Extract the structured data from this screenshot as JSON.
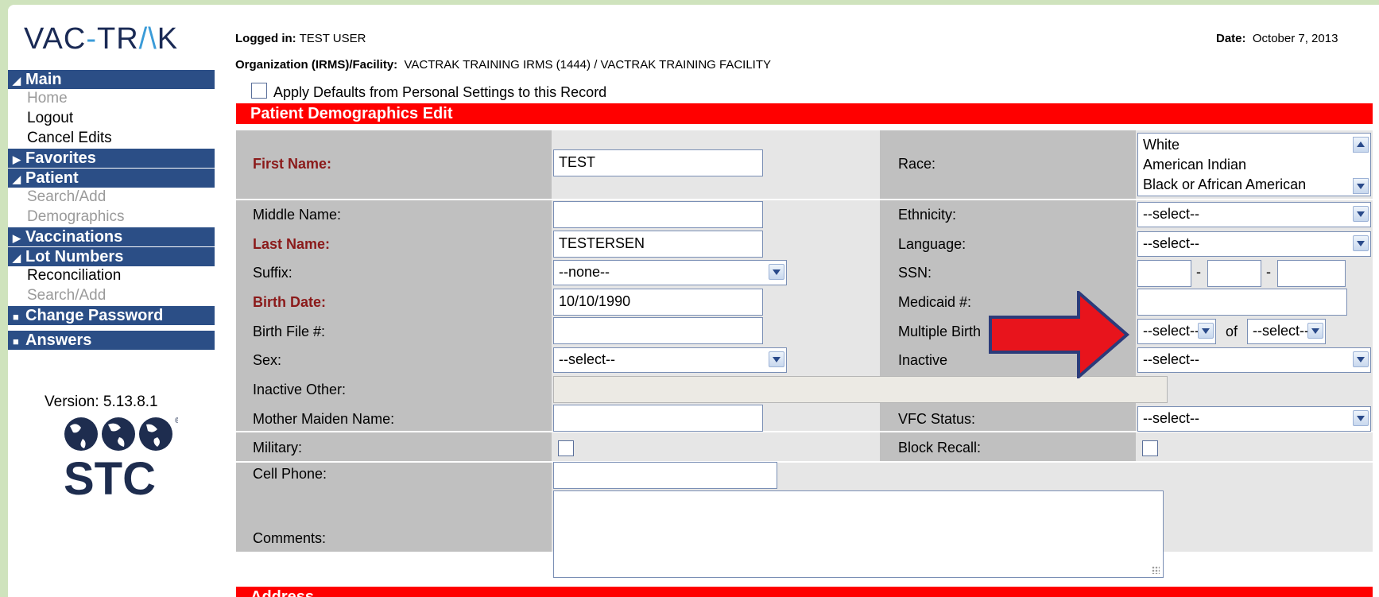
{
  "app": {
    "logo": "VACTRAK",
    "version": "Version: 5.13.8.1",
    "vendor_logo": "STC"
  },
  "sidebar": {
    "main": {
      "label": "Main",
      "items": [
        "Home",
        "Logout",
        "Cancel Edits"
      ]
    },
    "favorites": {
      "label": "Favorites"
    },
    "patient": {
      "label": "Patient",
      "items": [
        "Search/Add",
        "Demographics"
      ]
    },
    "vaccinations": {
      "label": "Vaccinations"
    },
    "lot_numbers": {
      "label": "Lot Numbers",
      "items": [
        "Reconciliation",
        "Search/Add"
      ]
    },
    "change_password": {
      "label": "Change Password"
    },
    "answers": {
      "label": "Answers"
    }
  },
  "header": {
    "logged_in_label": "Logged in:",
    "logged_in_value": "TEST USER",
    "org_label": "Organization (IRMS)/Facility:",
    "org_value": "VACTRAK TRAINING IRMS (1444) / VACTRAK TRAINING FACILITY",
    "date_label": "Date:",
    "date_value": "October 7, 2013",
    "apply_defaults": "Apply Defaults from Personal Settings to this Record"
  },
  "section_title": "Patient Demographics Edit",
  "next_section_title": "Address",
  "form": {
    "first_name": {
      "label": "First Name:",
      "value": "TEST"
    },
    "middle_name": {
      "label": "Middle Name:",
      "value": ""
    },
    "last_name": {
      "label": "Last Name:",
      "value": "TESTERSEN"
    },
    "suffix": {
      "label": "Suffix:",
      "value": "--none--"
    },
    "birth_date": {
      "label": "Birth Date:",
      "value": "10/10/1990"
    },
    "birth_file": {
      "label": "Birth File #:",
      "value": ""
    },
    "sex": {
      "label": "Sex:",
      "value": "--select--"
    },
    "inactive_other": {
      "label": "Inactive Other:",
      "value": ""
    },
    "mother_maiden": {
      "label": "Mother Maiden Name:",
      "value": ""
    },
    "military": {
      "label": "Military:"
    },
    "cell_phone": {
      "label": "Cell Phone:",
      "value": ""
    },
    "comments": {
      "label": "Comments:",
      "value": ""
    },
    "race": {
      "label": "Race:",
      "options": [
        "White",
        "American Indian",
        "Black or African American"
      ]
    },
    "ethnicity": {
      "label": "Ethnicity:",
      "value": "--select--"
    },
    "language": {
      "label": "Language:",
      "value": "--select--"
    },
    "ssn": {
      "label": "SSN:",
      "sep": "-"
    },
    "medicaid": {
      "label": "Medicaid #:",
      "value": ""
    },
    "multiple_birth": {
      "label": "Multiple Birth",
      "value1": "--select--",
      "of": "of",
      "value2": "--select--"
    },
    "inactive": {
      "label": "Inactive",
      "value": "--select--"
    },
    "vfc_status": {
      "label": "VFC Status:",
      "value": "--select--"
    },
    "block_recall": {
      "label": "Block Recall:"
    }
  },
  "colors": {
    "header_bar": "#ff0000",
    "nav_bar": "#2b4e86",
    "arrow": "#e8141c"
  }
}
